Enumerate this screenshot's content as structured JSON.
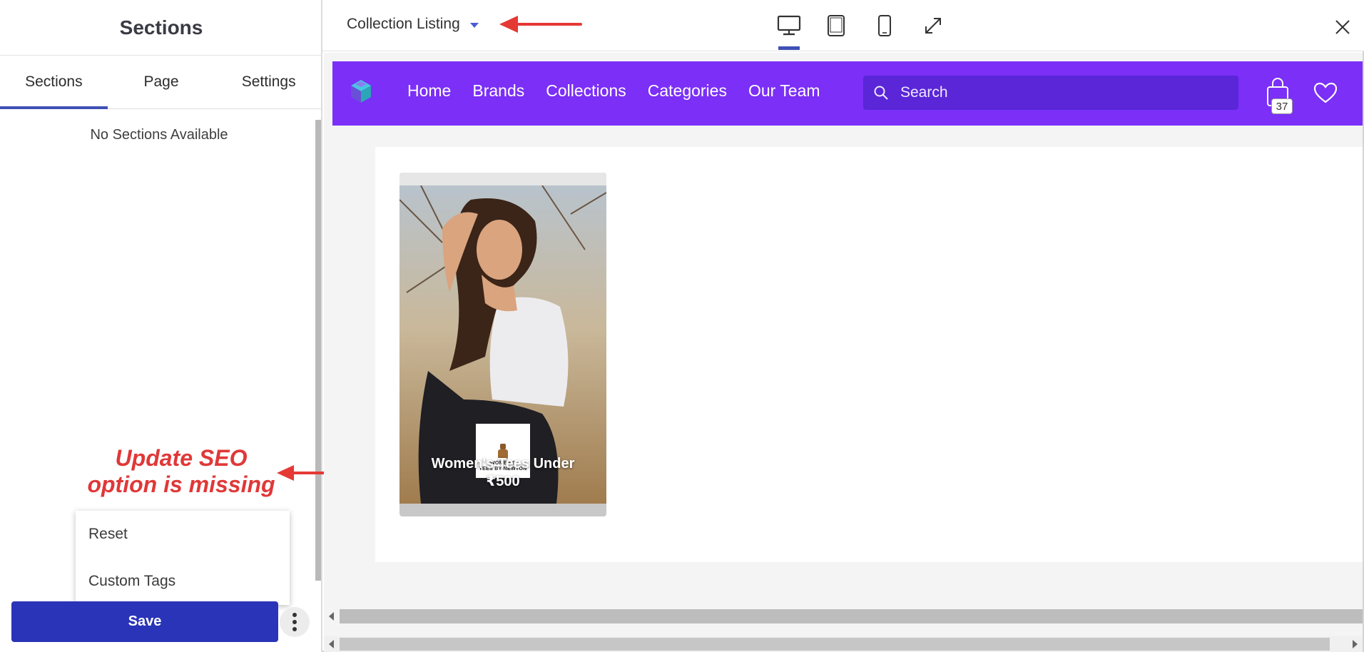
{
  "left_panel": {
    "title": "Sections",
    "tabs": [
      {
        "label": "Sections",
        "active": true
      },
      {
        "label": "Page",
        "active": false
      },
      {
        "label": "Settings",
        "active": false
      }
    ],
    "empty_message": "No Sections Available",
    "annotation": {
      "line1": "Update SEO",
      "line2": "option is missing",
      "color": "#e03838"
    },
    "menu": {
      "items": [
        "Reset",
        "Custom Tags"
      ]
    },
    "save_label": "Save",
    "save_color": "#2a34b8"
  },
  "topbar": {
    "page_selector": "Collection Listing",
    "devices": [
      {
        "name": "desktop-icon",
        "active": true
      },
      {
        "name": "tablet-icon",
        "active": false
      },
      {
        "name": "mobile-icon",
        "active": false
      },
      {
        "name": "expand-icon",
        "active": false
      }
    ],
    "accent": "#3f51b5"
  },
  "preview": {
    "navbar_color": "#7b2ff7",
    "nav_links": [
      "Home",
      "Brands",
      "Collections",
      "Categories",
      "Our Team"
    ],
    "search_placeholder": "Search",
    "cart_count": "37",
    "product": {
      "title_line1": "Women's Tees Under",
      "title_line2": "₹500",
      "brand_logo_text_1": "WOMEN'S",
      "brand_logo_text_2": "TEES BY NEWTON"
    }
  }
}
